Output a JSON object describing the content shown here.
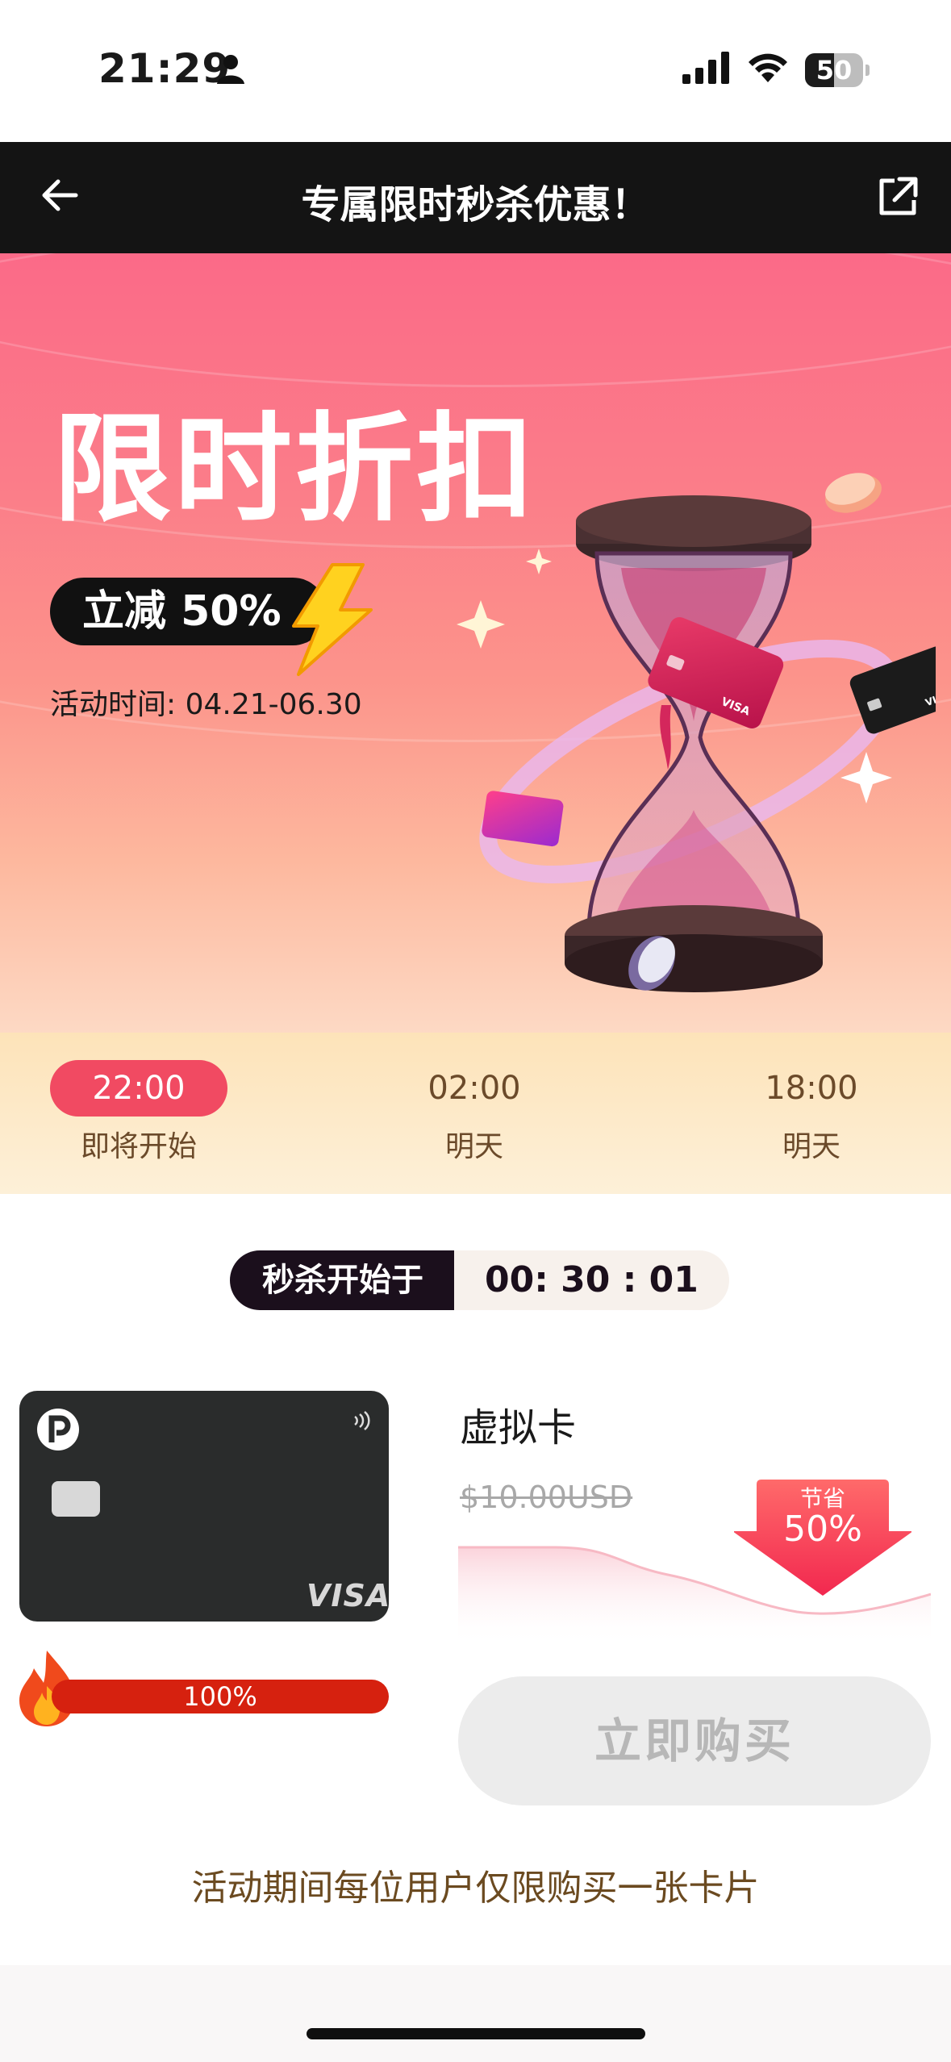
{
  "status_bar": {
    "time": "21:29",
    "battery": "50",
    "battery_level": 0.5
  },
  "nav": {
    "title": "专属限时秒杀优惠！"
  },
  "hero": {
    "title": "限时折扣",
    "discount": "立减 50%",
    "event_time": "活动时间: 04.21-06.30"
  },
  "slots": [
    {
      "time": "22:00",
      "label": "即将开始",
      "active": true
    },
    {
      "time": "02:00",
      "label": "明天",
      "active": false
    },
    {
      "time": "18:00",
      "label": "明天",
      "active": false
    }
  ],
  "countdown": {
    "label": "秒杀开始于",
    "value": "00: 30 : 01"
  },
  "product": {
    "name": "虚拟卡",
    "original_price": "$10.00USD",
    "save_label": "节省",
    "save_value": "50%",
    "card_brand": "VISA",
    "stock_progress": "100%",
    "stock_fraction": 1.0,
    "buy_label": "立即购买"
  },
  "notice": "活动期间每位用户仅限购买一张卡片",
  "colors": {
    "accent": "#f14a62",
    "nav_bg": "#141414",
    "progress": "#d6210f"
  }
}
